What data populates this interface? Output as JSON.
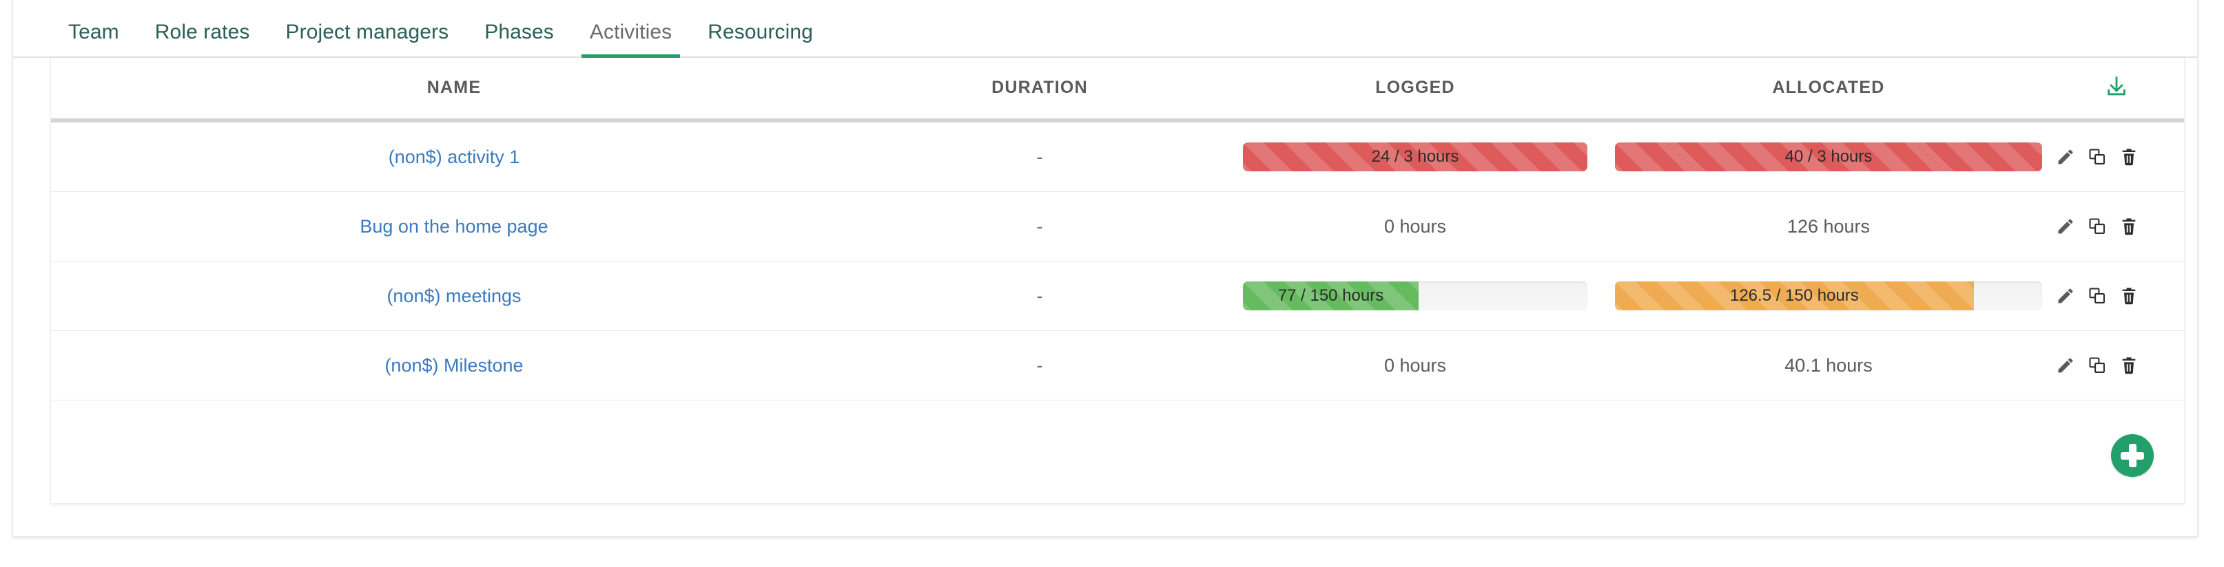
{
  "tabs": [
    {
      "label": "Team",
      "active": false
    },
    {
      "label": "Role rates",
      "active": false
    },
    {
      "label": "Project managers",
      "active": false
    },
    {
      "label": "Phases",
      "active": false
    },
    {
      "label": "Activities",
      "active": true
    },
    {
      "label": "Resourcing",
      "active": false
    }
  ],
  "table": {
    "columns": {
      "name": "NAME",
      "duration": "DURATION",
      "logged": "LOGGED",
      "allocated": "ALLOCATED",
      "export_icon": "download-icon"
    },
    "rows": [
      {
        "name": "(non$) activity 1",
        "duration": "-",
        "logged": {
          "type": "bar",
          "text": "24 / 3 hours",
          "value": 24,
          "total": 3,
          "percent": 100,
          "state": "danger",
          "color": "#dd5b5b"
        },
        "allocated": {
          "type": "bar",
          "text": "40 / 3 hours",
          "value": 40,
          "total": 3,
          "percent": 100,
          "state": "danger",
          "color": "#dd5b5b"
        }
      },
      {
        "name": "Bug on the home page",
        "duration": "-",
        "logged": {
          "type": "text",
          "text": "0 hours"
        },
        "allocated": {
          "type": "text",
          "text": "126 hours"
        }
      },
      {
        "name": "(non$) meetings",
        "duration": "-",
        "logged": {
          "type": "bar",
          "text": "77 / 150 hours",
          "value": 77,
          "total": 150,
          "percent": 51,
          "state": "success",
          "color": "#66bb5f"
        },
        "allocated": {
          "type": "bar",
          "text": "126.5 / 150 hours",
          "value": 126.5,
          "total": 150,
          "percent": 84,
          "state": "warning",
          "color": "#efab52"
        }
      },
      {
        "name": "(non$) Milestone",
        "duration": "-",
        "logged": {
          "type": "text",
          "text": "0 hours"
        },
        "allocated": {
          "type": "text",
          "text": "40.1 hours"
        }
      }
    ],
    "row_actions": [
      {
        "icon": "pencil-icon",
        "title": "Edit"
      },
      {
        "icon": "copy-icon",
        "title": "Duplicate"
      },
      {
        "icon": "trash-icon",
        "title": "Delete"
      }
    ]
  },
  "add_button": {
    "icon": "plus-icon",
    "color": "#22a06b"
  },
  "theme": {
    "accent_green": "#22a06b",
    "tab_text": "#2c5f58",
    "link_blue": "#3a7bbf",
    "danger": "#dd5b5b",
    "success": "#66bb5f",
    "warning": "#efab52"
  }
}
